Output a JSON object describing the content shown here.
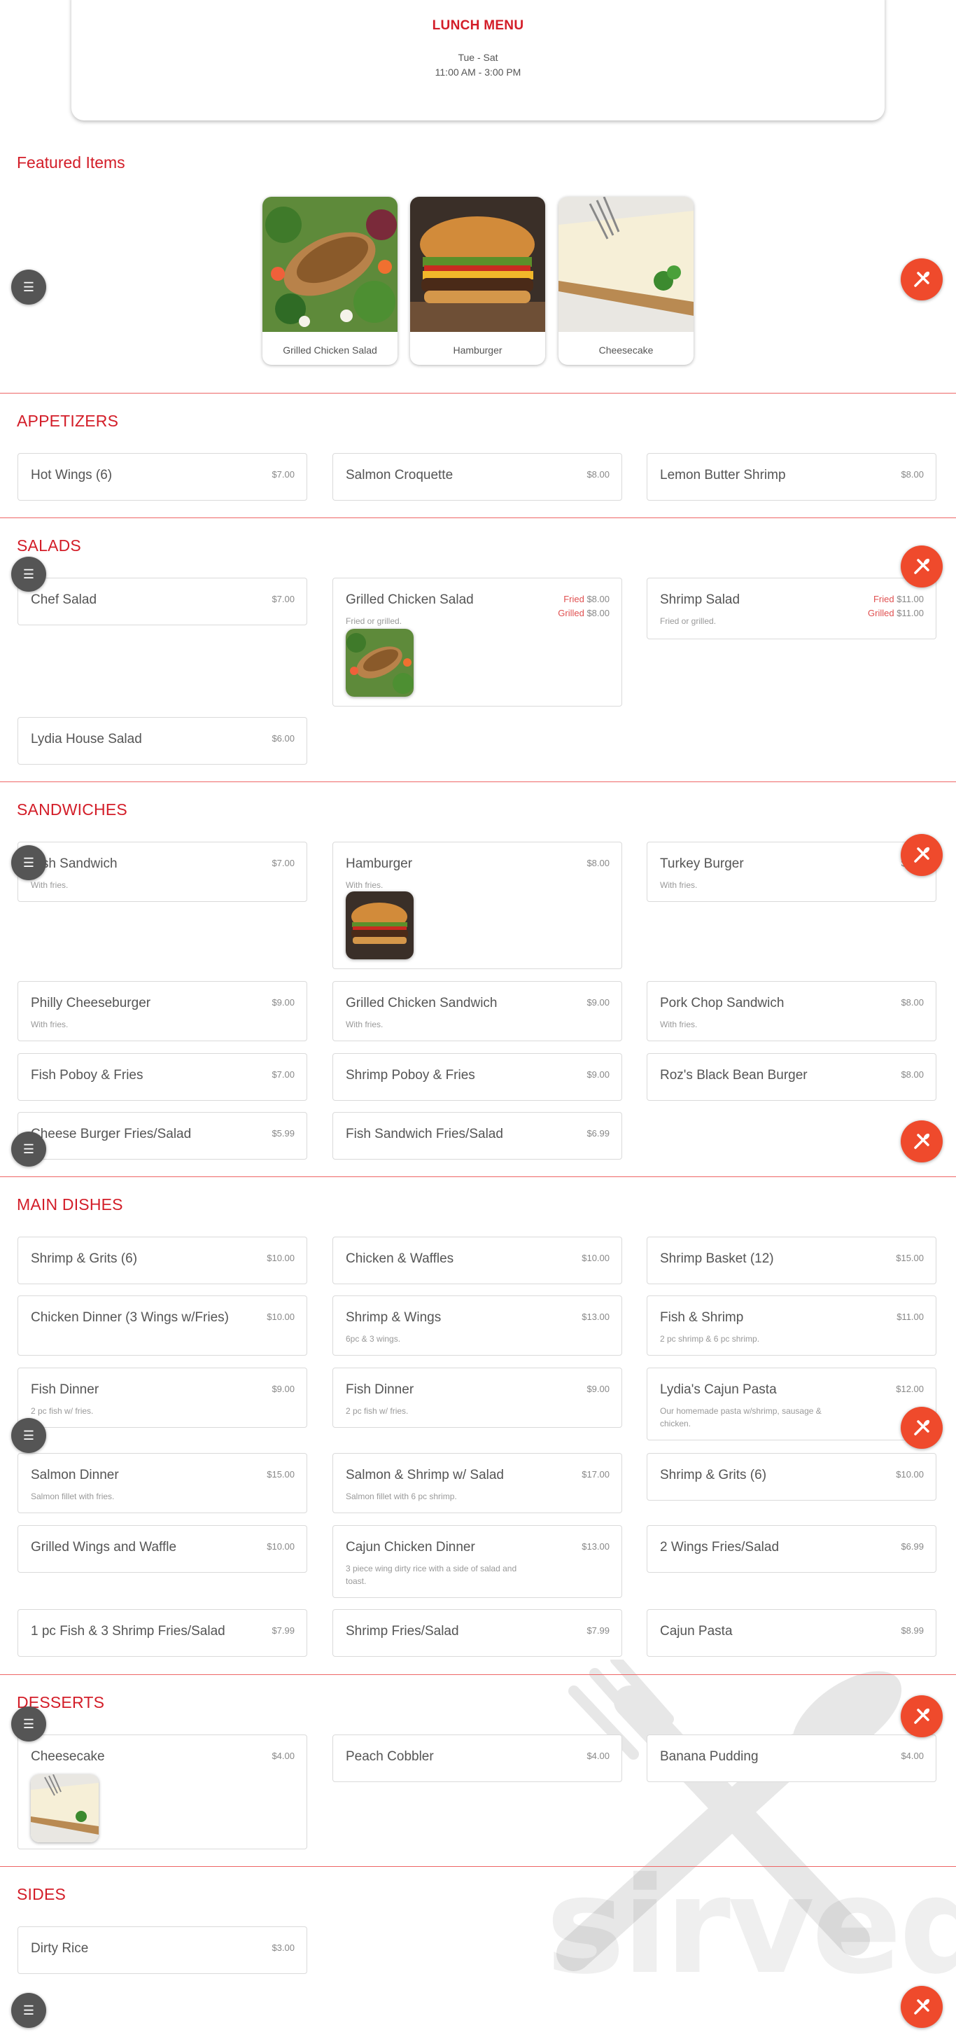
{
  "menu_card": {
    "name": "LUNCH MENU",
    "days": "Tue - Sat",
    "hours": "11:00 AM - 3:00 PM"
  },
  "featured": {
    "title": "Featured Items",
    "items": [
      {
        "label": "Grilled Chicken Salad",
        "image": "grilled-chicken-salad-photo"
      },
      {
        "label": "Hamburger",
        "image": "hamburger-photo"
      },
      {
        "label": "Cheesecake",
        "image": "cheesecake-photo"
      }
    ]
  },
  "sections": {
    "appetizers": {
      "title": "APPETIZERS",
      "items": [
        {
          "name": "Hot Wings (6)",
          "price": "$7.00"
        },
        {
          "name": "Salmon Croquette",
          "price": "$8.00"
        },
        {
          "name": "Lemon Butter Shrimp",
          "price": "$8.00"
        }
      ]
    },
    "salads": {
      "title": "SALADS",
      "items": [
        {
          "name": "Chef Salad",
          "price": "$7.00"
        },
        {
          "name": "Grilled Chicken Salad",
          "opt1": "Fried",
          "price1": "$8.00",
          "opt2": "Grilled",
          "price2": "$8.00",
          "desc": "Fried or grilled."
        },
        {
          "name": "Shrimp Salad",
          "opt1": "Fried",
          "price1": "$11.00",
          "opt2": "Grilled",
          "price2": "$11.00",
          "desc": "Fried or grilled."
        },
        {
          "name": "Lydia House Salad",
          "price": "$6.00"
        }
      ]
    },
    "sandwiches": {
      "title": "SANDWICHES",
      "items": [
        {
          "name": "Fish Sandwich",
          "price": "$7.00",
          "desc": "With fries."
        },
        {
          "name": "Hamburger",
          "price": "$8.00",
          "desc": "With fries."
        },
        {
          "name": "Turkey Burger",
          "price": "$7.00",
          "desc": "With fries."
        },
        {
          "name": "Philly Cheeseburger",
          "price": "$9.00",
          "desc": "With fries."
        },
        {
          "name": "Grilled Chicken Sandwich",
          "price": "$9.00",
          "desc": "With fries."
        },
        {
          "name": "Pork Chop Sandwich",
          "price": "$8.00",
          "desc": "With fries."
        },
        {
          "name": "Fish Poboy & Fries",
          "price": "$7.00"
        },
        {
          "name": "Shrimp Poboy & Fries",
          "price": "$9.00"
        },
        {
          "name": "Roz's Black Bean Burger",
          "price": "$8.00"
        },
        {
          "name": "Cheese Burger Fries/Salad",
          "price": "$5.99"
        },
        {
          "name": "Fish Sandwich Fries/Salad",
          "price": "$6.99"
        }
      ]
    },
    "main_dishes": {
      "title": "MAIN DISHES",
      "items": [
        {
          "name": "Shrimp & Grits (6)",
          "price": "$10.00"
        },
        {
          "name": "Chicken & Waffles",
          "price": "$10.00"
        },
        {
          "name": "Shrimp Basket (12)",
          "price": "$15.00"
        },
        {
          "name": "Chicken Dinner (3 Wings w/Fries)",
          "price": "$10.00"
        },
        {
          "name": "Shrimp & Wings",
          "price": "$13.00",
          "desc": "6pc & 3 wings."
        },
        {
          "name": "Fish & Shrimp",
          "price": "$11.00",
          "desc": "2 pc shrimp & 6 pc shrimp."
        },
        {
          "name": "Fish Dinner",
          "price": "$9.00",
          "desc": "2 pc fish w/ fries."
        },
        {
          "name": "Fish Dinner",
          "price": "$9.00",
          "desc": "2 pc fish w/ fries."
        },
        {
          "name": "Lydia's Cajun Pasta",
          "price": "$12.00",
          "desc": "Our homemade pasta w/shrimp, sausage & chicken."
        },
        {
          "name": "Salmon Dinner",
          "price": "$15.00",
          "desc": "Salmon fillet with fries."
        },
        {
          "name": "Salmon & Shrimp w/ Salad",
          "price": "$17.00",
          "desc": "Salmon fillet with 6 pc shrimp."
        },
        {
          "name": "Shrimp & Grits (6)",
          "price": "$10.00"
        },
        {
          "name": "Grilled Wings and Waffle",
          "price": "$10.00"
        },
        {
          "name": "Cajun Chicken Dinner",
          "price": "$13.00",
          "desc": "3 piece wing dirty rice with a side of salad and toast."
        },
        {
          "name": "2 Wings Fries/Salad",
          "price": "$6.99"
        },
        {
          "name": "1 pc Fish & 3 Shrimp Fries/Salad",
          "price": "$7.99"
        },
        {
          "name": "Shrimp Fries/Salad",
          "price": "$7.99"
        },
        {
          "name": "Cajun Pasta",
          "price": "$8.99"
        }
      ]
    },
    "desserts": {
      "title": "DESSERTS",
      "items": [
        {
          "name": "Cheesecake",
          "price": "$4.00"
        },
        {
          "name": "Peach Cobbler",
          "price": "$4.00"
        },
        {
          "name": "Banana Pudding",
          "price": "$4.00"
        }
      ]
    },
    "sides": {
      "title": "SIDES",
      "items": [
        {
          "name": "Dirty Rice",
          "price": "$3.00"
        }
      ]
    }
  },
  "watermark": {
    "text": "sirved"
  },
  "colors": {
    "accent": "#d31d28",
    "fab": "#ef4a2c",
    "fab_dark": "#555555"
  }
}
